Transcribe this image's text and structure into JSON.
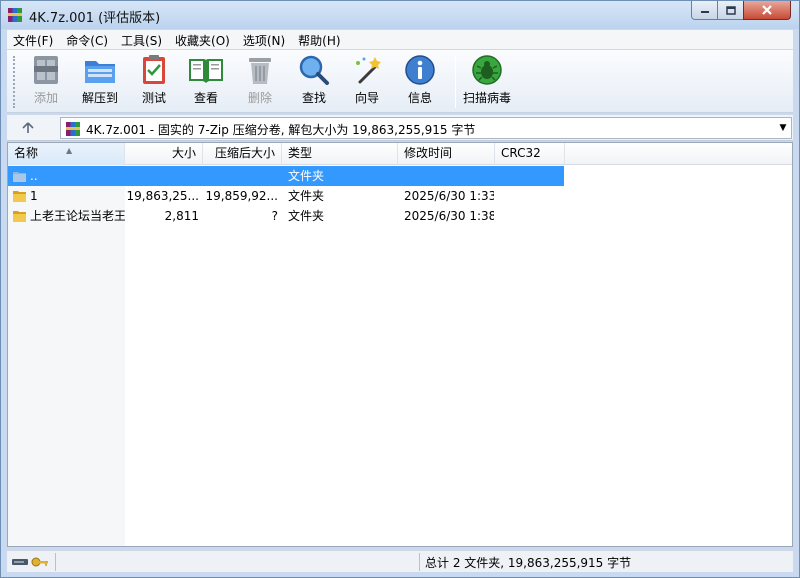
{
  "window": {
    "title": "4K.7z.001 (评估版本)"
  },
  "menubar": [
    "文件(F)",
    "命令(C)",
    "工具(S)",
    "收藏夹(O)",
    "选项(N)",
    "帮助(H)"
  ],
  "toolbar": {
    "add": "添加",
    "extract": "解压到",
    "test": "测试",
    "view": "查看",
    "delete": "删除",
    "find": "查找",
    "wizard": "向导",
    "info": "信息",
    "scan": "扫描病毒"
  },
  "address": {
    "text": "4K.7z.001 - 固实的 7-Zip 压缩分卷, 解包大小为 19,863,255,915 字节"
  },
  "columns": {
    "name": "名称",
    "size": "大小",
    "packed": "压缩后大小",
    "type": "类型",
    "modified": "修改时间",
    "crc": "CRC32"
  },
  "files": [
    {
      "name": "..",
      "size": "",
      "packed": "",
      "type": "文件夹",
      "modified": "",
      "crc": "",
      "icon": "parent-folder-icon",
      "selected": true
    },
    {
      "name": "1",
      "size": "19,863,25...",
      "packed": "19,859,92...",
      "type": "文件夹",
      "modified": "2025/6/30 1:33",
      "crc": "",
      "icon": "folder-icon",
      "selected": false
    },
    {
      "name": "上老王论坛当老王",
      "size": "2,811",
      "packed": "?",
      "type": "文件夹",
      "modified": "2025/6/30 1:38",
      "crc": "",
      "icon": "folder-icon",
      "selected": false
    }
  ],
  "status": {
    "text": "总计 2 文件夹, 19,863,255,915 字节"
  },
  "colors": {
    "selection": "#3399ff",
    "title_bar": "#c9daf0",
    "close_button": "#c74a34"
  }
}
